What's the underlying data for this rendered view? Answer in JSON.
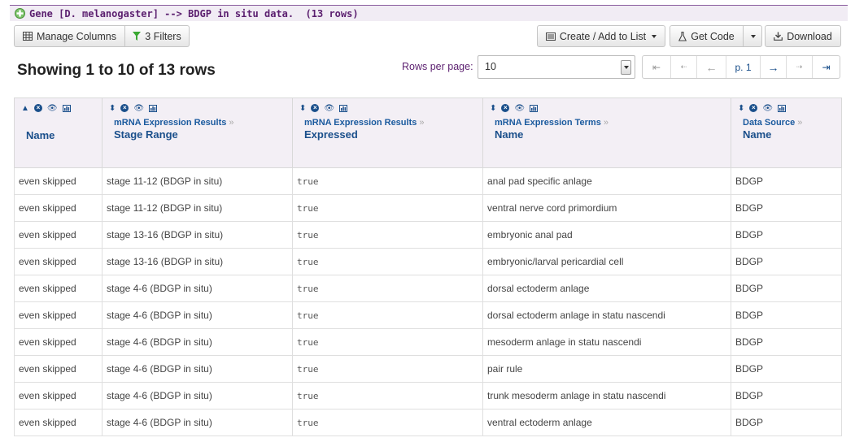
{
  "title_bar": {
    "text": "Gene [D. melanogaster] --> BDGP in situ data.  (13 rows)"
  },
  "toolbar": {
    "manage_columns": "Manage Columns",
    "filters": "3 Filters",
    "create_add_to_list": "Create / Add to List",
    "get_code": "Get Code",
    "download": "Download"
  },
  "summary": {
    "showing": "Showing 1 to 10 of 13 rows"
  },
  "pagination": {
    "rows_per_page_label": "Rows per page:",
    "rows_per_page_value": "10",
    "first": "⇤",
    "prev_page": "⇠",
    "prev": "←",
    "page": "p. 1",
    "next": "→",
    "next_page": "⇢",
    "last": "⇥"
  },
  "columns": [
    {
      "path": "",
      "name": "Name"
    },
    {
      "path": "mRNA Expression Results",
      "name": "Stage Range"
    },
    {
      "path": "mRNA Expression Results",
      "name": "Expressed"
    },
    {
      "path": "mRNA Expression Terms",
      "name": "Name"
    },
    {
      "path": "Data Source",
      "name": "Name"
    }
  ],
  "rows": [
    [
      "even skipped",
      "stage 11-12 (BDGP in situ)",
      "true",
      "anal pad specific anlage",
      "BDGP"
    ],
    [
      "even skipped",
      "stage 11-12 (BDGP in situ)",
      "true",
      "ventral nerve cord primordium",
      "BDGP"
    ],
    [
      "even skipped",
      "stage 13-16 (BDGP in situ)",
      "true",
      "embryonic anal pad",
      "BDGP"
    ],
    [
      "even skipped",
      "stage 13-16 (BDGP in situ)",
      "true",
      "embryonic/larval pericardial cell",
      "BDGP"
    ],
    [
      "even skipped",
      "stage 4-6 (BDGP in situ)",
      "true",
      "dorsal ectoderm anlage",
      "BDGP"
    ],
    [
      "even skipped",
      "stage 4-6 (BDGP in situ)",
      "true",
      "dorsal ectoderm anlage in statu nascendi",
      "BDGP"
    ],
    [
      "even skipped",
      "stage 4-6 (BDGP in situ)",
      "true",
      "mesoderm anlage in statu nascendi",
      "BDGP"
    ],
    [
      "even skipped",
      "stage 4-6 (BDGP in situ)",
      "true",
      "pair rule",
      "BDGP"
    ],
    [
      "even skipped",
      "stage 4-6 (BDGP in situ)",
      "true",
      "trunk mesoderm anlage in statu nascendi",
      "BDGP"
    ],
    [
      "even skipped",
      "stage 4-6 (BDGP in situ)",
      "true",
      "ventral ectoderm anlage",
      "BDGP"
    ]
  ],
  "colors": {
    "accent": "#5b1f6f",
    "link": "#1a4f8b",
    "header_bg": "#f3eff5",
    "filter_icon": "#3aa832"
  }
}
